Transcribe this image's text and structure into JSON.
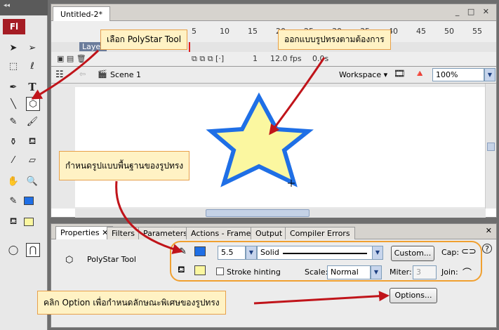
{
  "toolpanel": {
    "collapse_label": "◂◂",
    "logo": "Fl"
  },
  "document": {
    "tab_title": "Untitled-2*",
    "window_buttons": "_ □ ✕"
  },
  "timeline": {
    "layer_name": "Layer",
    "frame_numbers": [
      "5",
      "10",
      "15",
      "20",
      "25",
      "30",
      "35",
      "40",
      "45",
      "50",
      "55"
    ],
    "current_frame": "1",
    "fps": "12.0 fps",
    "elapsed": "0.0s"
  },
  "scenebar": {
    "scene_label": "Scene 1",
    "workspace_label": "Workspace",
    "zoom_value": "100%"
  },
  "properties": {
    "tabs": [
      "Properties",
      "Filters",
      "Parameters",
      "Actions - Frame",
      "Output",
      "Compiler Errors"
    ],
    "tool_name": "PolyStar Tool",
    "stroke_width": "5.5",
    "stroke_style": "Solid",
    "custom_label": "Custom...",
    "cap_label": "Cap:",
    "stroke_hinting_label": "Stroke hinting",
    "scale_label": "Scale:",
    "scale_value": "Normal",
    "miter_label": "Miter:",
    "miter_value": "3",
    "join_label": "Join:",
    "options_label": "Options...",
    "help_icon": "?"
  },
  "callouts": {
    "polystar": "เลือก PolyStar Tool",
    "design": "ออกแบบรูปทรงตามต้องการ",
    "basic": "กำหนดรูปแบบพื้นฐานของรูปทรง",
    "option": "คลิก Option เพื่อกำหนดลักษณะพิเศษของรูปทรง"
  },
  "colors": {
    "stroke": "#1f6fe6",
    "fill": "#fbf7a0",
    "callout_bg": "#fff2c4",
    "callout_border": "#e7a04a",
    "arrow": "#c0141a",
    "highlight_ring": "#f0a030"
  }
}
